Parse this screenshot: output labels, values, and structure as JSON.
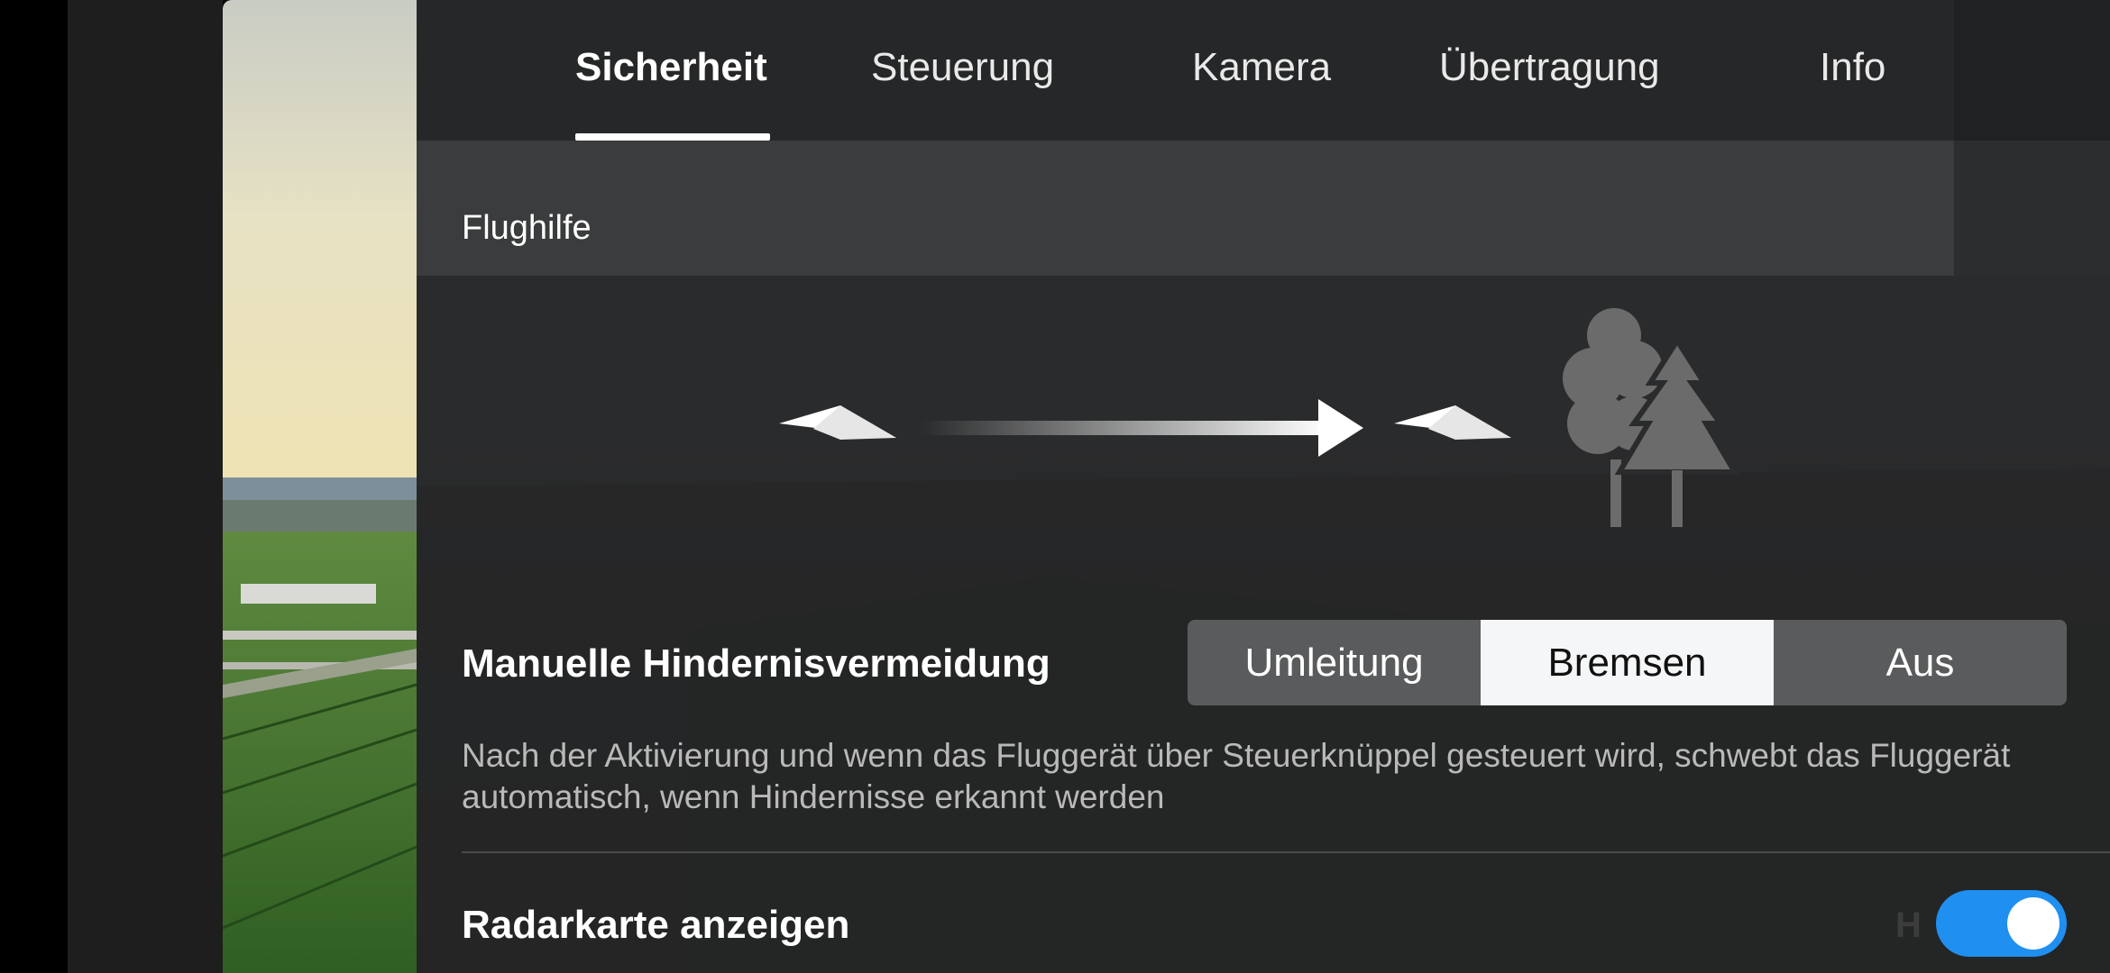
{
  "tabs": [
    {
      "label": "Sicherheit",
      "active": true
    },
    {
      "label": "Steuerung",
      "active": false
    },
    {
      "label": "Kamera",
      "active": false
    },
    {
      "label": "Übertragung",
      "active": false
    },
    {
      "label": "Info",
      "active": false
    }
  ],
  "section": {
    "title": "Flughilfe"
  },
  "illustration": {
    "icons": [
      "paper-plane-icon",
      "arrow-right-icon",
      "paper-plane-icon",
      "tree-icon"
    ]
  },
  "obstacle_avoidance": {
    "title": "Manuelle Hindernisvermeidung",
    "options": [
      "Umleitung",
      "Bremsen",
      "Aus"
    ],
    "selected": "Bremsen",
    "description": "Nach der Aktivierung und wenn das Fluggerät über Steuerknüppel gesteuert wird, schwebt das Fluggerät automatisch, wenn Hindernisse erkannt werden"
  },
  "radar": {
    "title": "Radarkarte anzeigen",
    "enabled": true
  },
  "colors": {
    "accent": "#1f8ff0",
    "panel": "#2a2b2c",
    "header": "#3b3c3d"
  }
}
